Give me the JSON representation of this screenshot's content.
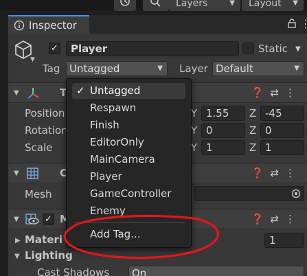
{
  "toolbar": {
    "layers_label": "Layers",
    "layout_label": "Layout"
  },
  "inspector": {
    "tab_label": "Inspector",
    "object_name": "Player",
    "active": true,
    "static_label": "Static",
    "tag_label": "Tag",
    "tag_value": "Untagged",
    "layer_label": "Layer",
    "layer_value": "Default"
  },
  "transform": {
    "header_label": "T",
    "position_label": "Position",
    "rotation_label": "Rotation",
    "scale_label": "Scale",
    "position": {
      "y": "1.55",
      "z": "-45"
    },
    "rotation": {
      "y": "0",
      "z": "0"
    },
    "scale": {
      "y": "1",
      "z": "1"
    },
    "y_axis": "Y",
    "z_axis": "Z"
  },
  "mesh_filter": {
    "header_label": "C",
    "mesh_label": "Mesh"
  },
  "mesh_renderer": {
    "header_label": "M",
    "materials_label": "Materi",
    "materials_count": "1",
    "lighting_label": "Lighting",
    "cast_shadows_label": "Cast Shadows",
    "cast_shadows_value": "On"
  },
  "tag_menu": {
    "selected_check": "✓",
    "items": [
      "Untagged",
      "Respawn",
      "Finish",
      "EditorOnly",
      "MainCamera",
      "Player",
      "GameController",
      "Enemy"
    ],
    "add_tag_label": "Add Tag..."
  },
  "annotation_color": "#e01818"
}
